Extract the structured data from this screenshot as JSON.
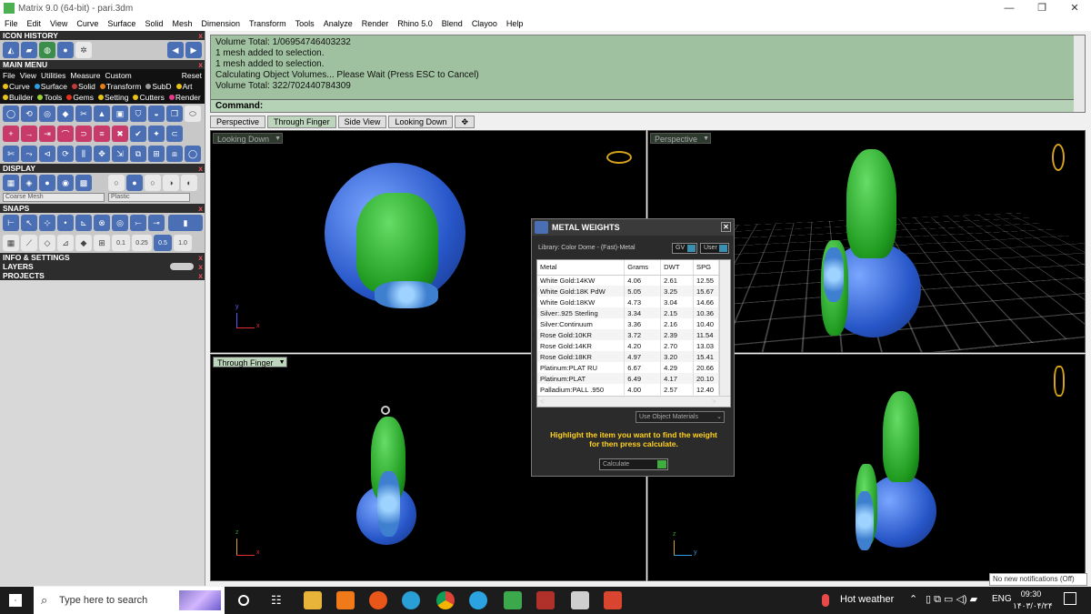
{
  "window": {
    "title": "Matrix 9.0 (64-bit) - pari.3dm",
    "minimize": "—",
    "restore": "❐",
    "close": "✕"
  },
  "menubar": [
    "File",
    "Edit",
    "View",
    "Curve",
    "Surface",
    "Solid",
    "Mesh",
    "Dimension",
    "Transform",
    "Tools",
    "Analyze",
    "Render",
    "Rhino 5.0",
    "Blend",
    "Clayoo",
    "Help"
  ],
  "left_panel": {
    "icon_history": "ICON HISTORY",
    "main_menu": "MAIN MENU",
    "main_menu_row1": [
      "File",
      "View",
      "Utilities",
      "Measure",
      "Custom"
    ],
    "reset": "Reset",
    "main_menu_row2": [
      {
        "label": "Curve",
        "color": "#e6c21a"
      },
      {
        "label": "Surface",
        "color": "#2f9ee0"
      },
      {
        "label": "Solid",
        "color": "#c33a3a"
      },
      {
        "label": "Transform",
        "color": "#e67c1a"
      },
      {
        "label": "SubD",
        "color": "#9a9a9a"
      },
      {
        "label": "Art",
        "color": "#e6c21a"
      }
    ],
    "main_menu_row3": [
      {
        "label": "Builder",
        "color": "#e6c21a"
      },
      {
        "label": "Tools",
        "color": "#9ad23a"
      },
      {
        "label": "Gems",
        "color": "#e6331a"
      },
      {
        "label": "Setting",
        "color": "#e6c21a"
      },
      {
        "label": "Cutters",
        "color": "#e6c21a"
      },
      {
        "label": "Render",
        "color": "#e63a8a"
      }
    ],
    "display": "DISPLAY",
    "display_mesh": "Coarse Mesh",
    "display_material": "Plastic",
    "snaps": "SNAPS",
    "snap_values": [
      "0.1",
      "0.25",
      "0.5",
      "1.0"
    ],
    "info_settings": "INFO & SETTINGS",
    "layers": "LAYERS",
    "projects": "PROJECTS",
    "close_glyph": "x"
  },
  "command_history": [
    "Volume Total: 1/06954746403232",
    "1 mesh added to selection.",
    "1 mesh added to selection.",
    "Calculating Object Volumes... Please Wait (Press ESC to Cancel)",
    "Volume Total: 322/702440784309"
  ],
  "command_label": "Command:",
  "tabs": [
    "Perspective",
    "Through Finger",
    "Side View",
    "Looking Down",
    "✥"
  ],
  "active_tab_index": 1,
  "viewports": {
    "top_left": "Looking Down",
    "top_right": "Perspective",
    "bottom_left": "Through Finger",
    "bottom_right": ""
  },
  "axis_labels": {
    "y": "y",
    "x": "x",
    "z": "z"
  },
  "metal_weights": {
    "title": "METAL WEIGHTS",
    "library": "Library: Color Dome - (Fast)-Metal",
    "chip_gv": "GV",
    "chip_user": "User",
    "columns": [
      "Metal",
      "Grams",
      "DWT",
      "SPG"
    ],
    "rows": [
      [
        "White Gold:14KW",
        "4.06",
        "2.61",
        "12.55"
      ],
      [
        "White Gold:18K PdW",
        "5.05",
        "3.25",
        "15.67"
      ],
      [
        "White Gold:18KW",
        "4.73",
        "3.04",
        "14.66"
      ],
      [
        "Silver:.925 Sterling",
        "3.34",
        "2.15",
        "10.36"
      ],
      [
        "Silver:Continuum",
        "3.36",
        "2.16",
        "10.40"
      ],
      [
        "Rose Gold:10KR",
        "3.72",
        "2.39",
        "11.54"
      ],
      [
        "Rose Gold:14KR",
        "4.20",
        "2.70",
        "13.03"
      ],
      [
        "Rose Gold:18KR",
        "4.97",
        "3.20",
        "15.41"
      ],
      [
        "Platinum:PLAT RU",
        "6.67",
        "4.29",
        "20.66"
      ],
      [
        "Platinum:PLAT",
        "6.49",
        "4.17",
        "20.10"
      ],
      [
        "Palladium:PALL .950",
        "4.00",
        "2.57",
        "12.40"
      ]
    ],
    "use_materials": "Use Object Materials",
    "hint_line1": "Highlight the item you want to find the weight",
    "hint_line2": "for then press calculate.",
    "calculate": "Calculate",
    "scroll_left": "<",
    "scroll_right": ">"
  },
  "notification": "No new notifications (Off)",
  "taskbar": {
    "search_placeholder": "Type here to search",
    "weather": "Hot weather",
    "language": "ENG",
    "time": "09:30",
    "date": "۱۴۰۳/۰۴/۲۴"
  }
}
